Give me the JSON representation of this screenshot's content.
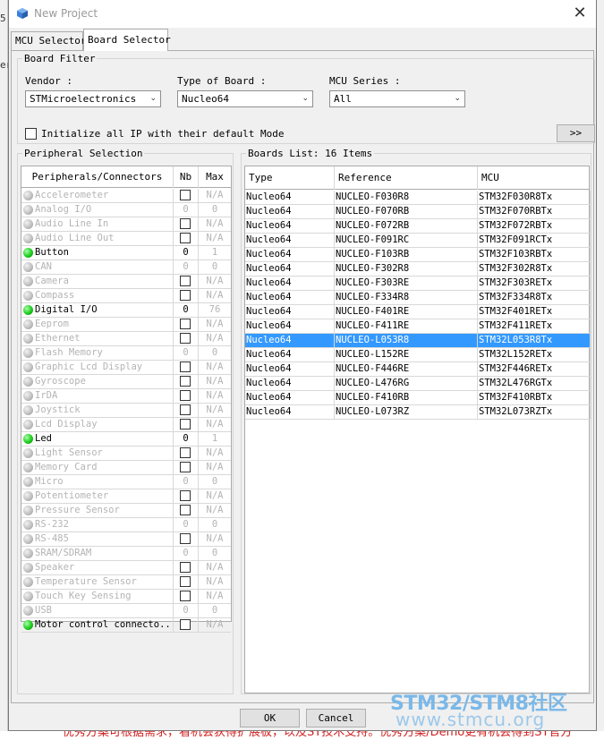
{
  "background": {
    "left_text_1": "5",
    "left_text_2": "er",
    "bottom_text": "优秀方案可根据需求，看机会获得扩展板，以及ST技术支持。优秀方案/Demo更有机会得到ST官方"
  },
  "dialog": {
    "title": "New Project",
    "close_glyph": "✕",
    "tabs": [
      {
        "label": "MCU Selector",
        "active": false
      },
      {
        "label": "Board Selector",
        "active": true
      }
    ]
  },
  "board_filter": {
    "title": "Board Filter",
    "vendor": {
      "label": "Vendor :",
      "value": "STMicroelectronics"
    },
    "board_type": {
      "label": "Type of Board :",
      "value": "Nucleo64"
    },
    "mcu_series": {
      "label": "MCU Series :",
      "value": "All"
    },
    "init_ip_label": "Initialize all IP with their default Mode",
    "init_ip_checked": false,
    "expand_label": ">>"
  },
  "peripheral_selection": {
    "title": "Peripheral Selection",
    "columns": [
      "Peripherals/Connectors",
      "Nb",
      "Max"
    ],
    "rows": [
      {
        "name": "Accelerometer",
        "enabled": false,
        "nb": "",
        "checkbox": true,
        "max": "N/A"
      },
      {
        "name": "Analog I/O",
        "enabled": false,
        "nb": "0",
        "checkbox": false,
        "max": "0"
      },
      {
        "name": "Audio Line In",
        "enabled": false,
        "nb": "",
        "checkbox": true,
        "max": "N/A"
      },
      {
        "name": "Audio Line Out",
        "enabled": false,
        "nb": "",
        "checkbox": true,
        "max": "N/A"
      },
      {
        "name": "Button",
        "enabled": true,
        "nb": "0",
        "checkbox": false,
        "max": "1"
      },
      {
        "name": "CAN",
        "enabled": false,
        "nb": "0",
        "checkbox": false,
        "max": "0"
      },
      {
        "name": "Camera",
        "enabled": false,
        "nb": "",
        "checkbox": true,
        "max": "N/A"
      },
      {
        "name": "Compass",
        "enabled": false,
        "nb": "",
        "checkbox": true,
        "max": "N/A"
      },
      {
        "name": "Digital I/O",
        "enabled": true,
        "nb": "0",
        "checkbox": false,
        "max": "76"
      },
      {
        "name": "Eeprom",
        "enabled": false,
        "nb": "",
        "checkbox": true,
        "max": "N/A"
      },
      {
        "name": "Ethernet",
        "enabled": false,
        "nb": "",
        "checkbox": true,
        "max": "N/A"
      },
      {
        "name": "Flash Memory",
        "enabled": false,
        "nb": "0",
        "checkbox": false,
        "max": "0"
      },
      {
        "name": "Graphic Lcd Display",
        "enabled": false,
        "nb": "",
        "checkbox": true,
        "max": "N/A"
      },
      {
        "name": "Gyroscope",
        "enabled": false,
        "nb": "",
        "checkbox": true,
        "max": "N/A"
      },
      {
        "name": "IrDA",
        "enabled": false,
        "nb": "",
        "checkbox": true,
        "max": "N/A"
      },
      {
        "name": "Joystick",
        "enabled": false,
        "nb": "",
        "checkbox": true,
        "max": "N/A"
      },
      {
        "name": "Lcd Display",
        "enabled": false,
        "nb": "",
        "checkbox": true,
        "max": "N/A"
      },
      {
        "name": "Led",
        "enabled": true,
        "nb": "0",
        "checkbox": false,
        "max": "1"
      },
      {
        "name": "Light Sensor",
        "enabled": false,
        "nb": "",
        "checkbox": true,
        "max": "N/A"
      },
      {
        "name": "Memory Card",
        "enabled": false,
        "nb": "",
        "checkbox": true,
        "max": "N/A"
      },
      {
        "name": "Micro",
        "enabled": false,
        "nb": "0",
        "checkbox": false,
        "max": "0"
      },
      {
        "name": "Potentiometer",
        "enabled": false,
        "nb": "",
        "checkbox": true,
        "max": "N/A"
      },
      {
        "name": "Pressure Sensor",
        "enabled": false,
        "nb": "",
        "checkbox": true,
        "max": "N/A"
      },
      {
        "name": "RS-232",
        "enabled": false,
        "nb": "0",
        "checkbox": false,
        "max": "0"
      },
      {
        "name": "RS-485",
        "enabled": false,
        "nb": "",
        "checkbox": true,
        "max": "N/A"
      },
      {
        "name": "SRAM/SDRAM",
        "enabled": false,
        "nb": "0",
        "checkbox": false,
        "max": "0"
      },
      {
        "name": "Speaker",
        "enabled": false,
        "nb": "",
        "checkbox": true,
        "max": "N/A"
      },
      {
        "name": "Temperature Sensor",
        "enabled": false,
        "nb": "",
        "checkbox": true,
        "max": "N/A"
      },
      {
        "name": "Touch Key Sensing",
        "enabled": false,
        "nb": "",
        "checkbox": true,
        "max": "N/A"
      },
      {
        "name": "USB",
        "enabled": false,
        "nb": "0",
        "checkbox": false,
        "max": "0"
      },
      {
        "name": "Motor control connecto...",
        "enabled": true,
        "nb": "",
        "checkbox": true,
        "max": "N/A"
      }
    ]
  },
  "boards_list": {
    "title": "Boards List: 16 Items",
    "columns": [
      "Type",
      "Reference",
      "MCU"
    ],
    "selected_index": 10,
    "rows": [
      {
        "type": "Nucleo64",
        "reference": "NUCLEO-F030R8",
        "mcu": "STM32F030R8Tx"
      },
      {
        "type": "Nucleo64",
        "reference": "NUCLEO-F070RB",
        "mcu": "STM32F070RBTx"
      },
      {
        "type": "Nucleo64",
        "reference": "NUCLEO-F072RB",
        "mcu": "STM32F072RBTx"
      },
      {
        "type": "Nucleo64",
        "reference": "NUCLEO-F091RC",
        "mcu": "STM32F091RCTx"
      },
      {
        "type": "Nucleo64",
        "reference": "NUCLEO-F103RB",
        "mcu": "STM32F103RBTx"
      },
      {
        "type": "Nucleo64",
        "reference": "NUCLEO-F302R8",
        "mcu": "STM32F302R8Tx"
      },
      {
        "type": "Nucleo64",
        "reference": "NUCLEO-F303RE",
        "mcu": "STM32F303RETx"
      },
      {
        "type": "Nucleo64",
        "reference": "NUCLEO-F334R8",
        "mcu": "STM32F334R8Tx"
      },
      {
        "type": "Nucleo64",
        "reference": "NUCLEO-F401RE",
        "mcu": "STM32F401RETx"
      },
      {
        "type": "Nucleo64",
        "reference": "NUCLEO-F411RE",
        "mcu": "STM32F411RETx"
      },
      {
        "type": "Nucleo64",
        "reference": "NUCLEO-L053R8",
        "mcu": "STM32L053R8Tx"
      },
      {
        "type": "Nucleo64",
        "reference": "NUCLEO-L152RE",
        "mcu": "STM32L152RETx"
      },
      {
        "type": "Nucleo64",
        "reference": "NUCLEO-F446RE",
        "mcu": "STM32F446RETx"
      },
      {
        "type": "Nucleo64",
        "reference": "NUCLEO-L476RG",
        "mcu": "STM32L476RGTx"
      },
      {
        "type": "Nucleo64",
        "reference": "NUCLEO-F410RB",
        "mcu": "STM32F410RBTx"
      },
      {
        "type": "Nucleo64",
        "reference": "NUCLEO-L073RZ",
        "mcu": "STM32L073RZTx"
      }
    ]
  },
  "buttons": {
    "ok": "OK",
    "cancel": "Cancel"
  },
  "watermark": {
    "line1": "STM32/STM8社区",
    "line2": "www.stmcu.org"
  },
  "colors": {
    "selection": "#3399ff",
    "status_on": "#1ccc1c",
    "status_off": "#bdbdbd"
  }
}
